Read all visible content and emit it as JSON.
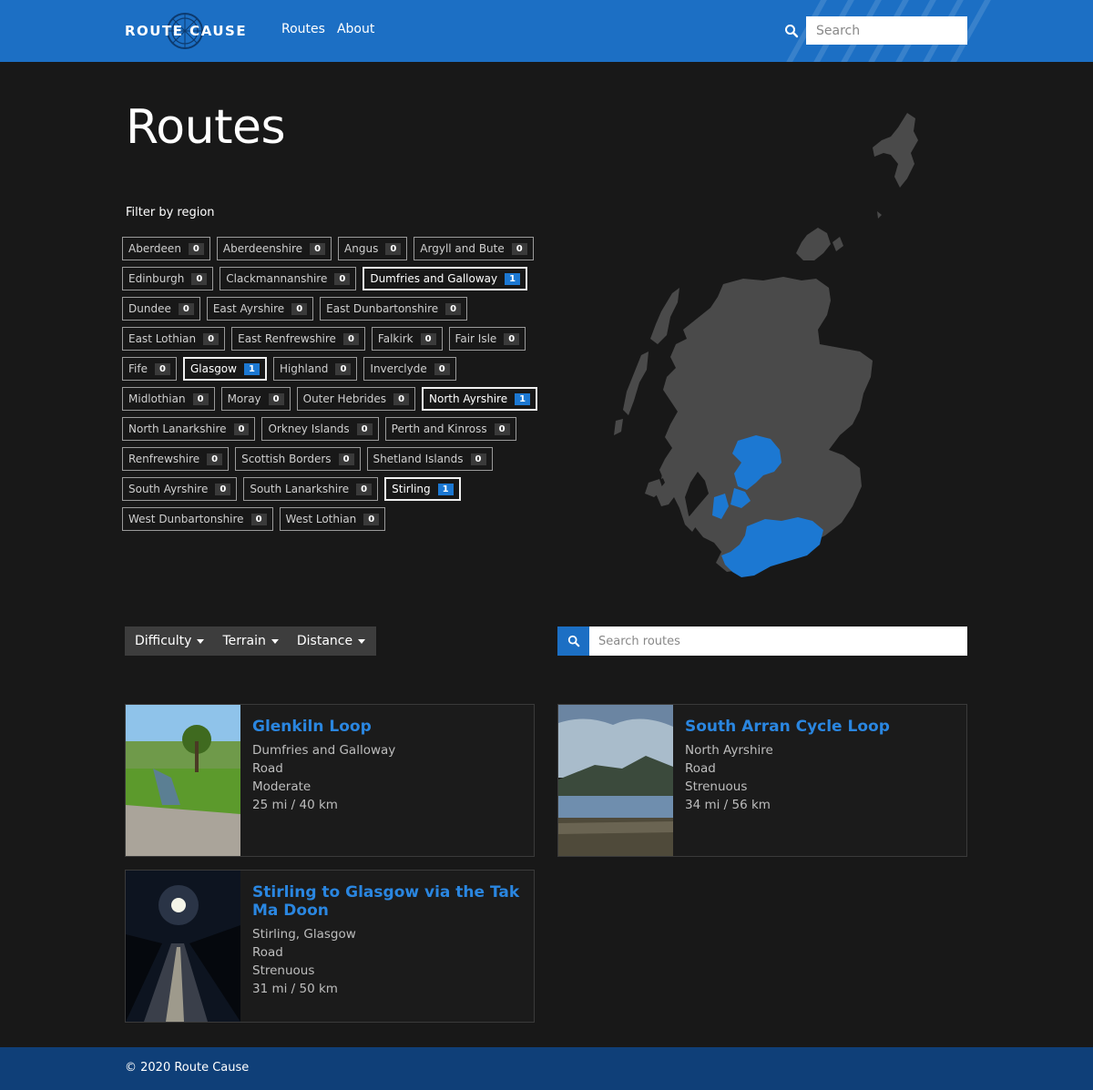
{
  "header": {
    "logo_text": "ROUTE CAUSE",
    "nav": [
      "Routes",
      "About"
    ],
    "search_placeholder": "Search",
    "brand_color": "#1c6fc4"
  },
  "page": {
    "title": "Routes",
    "filter_label": "Filter by region"
  },
  "regions": [
    {
      "name": "Aberdeen",
      "count": "0",
      "active": false
    },
    {
      "name": "Aberdeenshire",
      "count": "0",
      "active": false
    },
    {
      "name": "Angus",
      "count": "0",
      "active": false
    },
    {
      "name": "Argyll and Bute",
      "count": "0",
      "active": false
    },
    {
      "name": "Edinburgh",
      "count": "0",
      "active": false
    },
    {
      "name": "Clackmannanshire",
      "count": "0",
      "active": false
    },
    {
      "name": "Dumfries and Galloway",
      "count": "1",
      "active": true
    },
    {
      "name": "Dundee",
      "count": "0",
      "active": false
    },
    {
      "name": "East Ayrshire",
      "count": "0",
      "active": false
    },
    {
      "name": "East Dunbartonshire",
      "count": "0",
      "active": false
    },
    {
      "name": "East Lothian",
      "count": "0",
      "active": false
    },
    {
      "name": "East Renfrewshire",
      "count": "0",
      "active": false
    },
    {
      "name": "Falkirk",
      "count": "0",
      "active": false
    },
    {
      "name": "Fair Isle",
      "count": "0",
      "active": false
    },
    {
      "name": "Fife",
      "count": "0",
      "active": false
    },
    {
      "name": "Glasgow",
      "count": "1",
      "active": true
    },
    {
      "name": "Highland",
      "count": "0",
      "active": false
    },
    {
      "name": "Inverclyde",
      "count": "0",
      "active": false
    },
    {
      "name": "Midlothian",
      "count": "0",
      "active": false
    },
    {
      "name": "Moray",
      "count": "0",
      "active": false
    },
    {
      "name": "Outer Hebrides",
      "count": "0",
      "active": false
    },
    {
      "name": "North Ayrshire",
      "count": "1",
      "active": true
    },
    {
      "name": "North Lanarkshire",
      "count": "0",
      "active": false
    },
    {
      "name": "Orkney Islands",
      "count": "0",
      "active": false
    },
    {
      "name": "Perth and Kinross",
      "count": "0",
      "active": false
    },
    {
      "name": "Renfrewshire",
      "count": "0",
      "active": false
    },
    {
      "name": "Scottish Borders",
      "count": "0",
      "active": false
    },
    {
      "name": "Shetland Islands",
      "count": "0",
      "active": false
    },
    {
      "name": "South Ayrshire",
      "count": "0",
      "active": false
    },
    {
      "name": "South Lanarkshire",
      "count": "0",
      "active": false
    },
    {
      "name": "Stirling",
      "count": "1",
      "active": true
    },
    {
      "name": "West Dunbartonshire",
      "count": "0",
      "active": false
    },
    {
      "name": "West Lothian",
      "count": "0",
      "active": false
    }
  ],
  "filters": {
    "difficulty": "Difficulty",
    "terrain": "Terrain",
    "distance": "Distance",
    "search_placeholder": "Search routes"
  },
  "routes": [
    {
      "title": "Glenkiln Loop",
      "region": "Dumfries and Galloway",
      "terrain": "Road",
      "difficulty": "Moderate",
      "distance": "25 mi / 40 km"
    },
    {
      "title": "South Arran Cycle Loop",
      "region": "North Ayrshire",
      "terrain": "Road",
      "difficulty": "Strenuous",
      "distance": "34 mi / 56 km"
    },
    {
      "title": "Stirling to Glasgow via the Tak Ma Doon",
      "region": "Stirling, Glasgow",
      "terrain": "Road",
      "difficulty": "Strenuous",
      "distance": "31 mi / 50 km"
    }
  ],
  "footer": {
    "text": "© 2020 Route Cause"
  },
  "colors": {
    "map_land": "#4a4a4a",
    "map_highlight": "#1c78d2",
    "link": "#2a86e0"
  }
}
